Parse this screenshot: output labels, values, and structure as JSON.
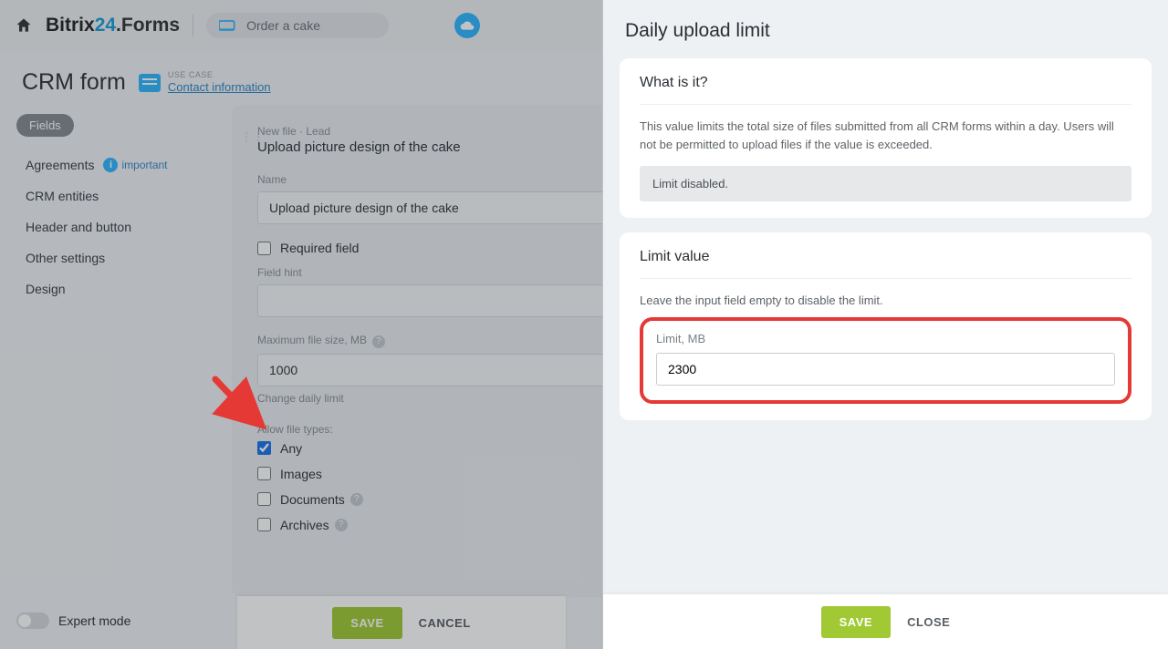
{
  "brand": {
    "prefix": "Bitrix",
    "num": "24",
    "suffix": ".Forms"
  },
  "search": {
    "placeholder": "Order a cake"
  },
  "page": {
    "title": "CRM form",
    "usecase_label": "USE CASE",
    "usecase_link": "Contact information"
  },
  "sidebar": {
    "active": "Fields",
    "items": [
      "Agreements",
      "CRM entities",
      "Header and button",
      "Other settings",
      "Design"
    ],
    "important": "important"
  },
  "main": {
    "crumb": "New file · Lead",
    "title": "Upload picture design of the cake",
    "name_label": "Name",
    "name_value": "Upload picture design of the cake",
    "required_label": "Required field",
    "hint_label": "Field hint",
    "hint_value": "",
    "max_label": "Maximum file size, MB",
    "max_value": "1000",
    "change_link": "Change daily limit",
    "allow_label": "Allow file types:",
    "types": {
      "any": "Any",
      "images": "Images",
      "documents": "Documents",
      "archives": "Archives"
    }
  },
  "expert": "Expert mode",
  "buttons": {
    "save": "SAVE",
    "cancel": "CANCEL",
    "close": "CLOSE"
  },
  "panel": {
    "title": "Daily upload limit",
    "whatis": "What is it?",
    "whatis_body": "This value limits the total size of files submitted from all CRM forms within a day. Users will not be permitted to upload files if the value is exceeded.",
    "disabled_msg": "Limit disabled.",
    "limit_heading": "Limit value",
    "limit_help": "Leave the input field empty to disable the limit.",
    "limit_label": "Limit, MB",
    "limit_value": "2300"
  }
}
